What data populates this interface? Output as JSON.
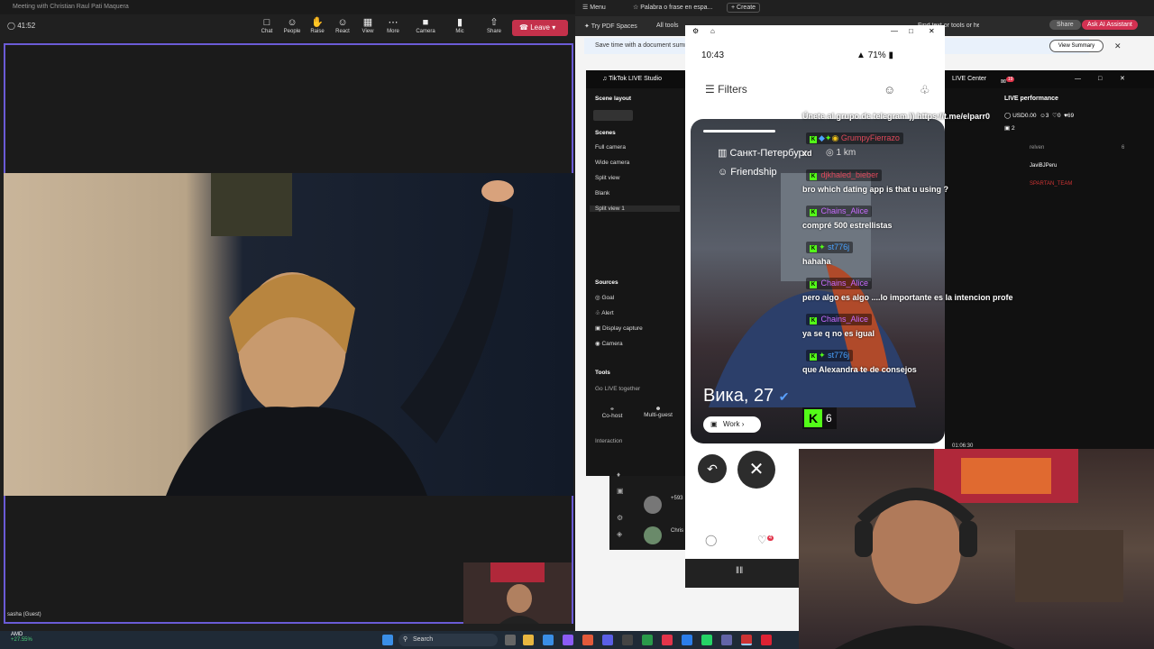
{
  "teams": {
    "window_title": "Meeting with Christian Raul Pati Maquera",
    "timer": "41:52",
    "toolbar": [
      {
        "label": "Chat",
        "icon": "chat-icon"
      },
      {
        "label": "People",
        "icon": "people-icon"
      },
      {
        "label": "Raise",
        "icon": "raise-hand-icon"
      },
      {
        "label": "React",
        "icon": "react-icon"
      },
      {
        "label": "View",
        "icon": "view-icon"
      },
      {
        "label": "More",
        "icon": "more-icon"
      },
      {
        "label": "Camera",
        "icon": "camera-icon"
      },
      {
        "label": "Mic",
        "icon": "mic-icon"
      },
      {
        "label": "Share",
        "icon": "share-icon"
      }
    ],
    "leave_label": "Leave",
    "participant_label": "sasha (Guest)"
  },
  "taskbar": {
    "stock_name": "AMD",
    "stock_change": "+27.55%",
    "search_label": "Search"
  },
  "browser": {
    "menu_label": "Menu",
    "tab_title": "Palabra o frase en espa...",
    "new_tab": "Create",
    "pdf_spaces": "Try PDF Spaces",
    "all_tools": "All tools",
    "find_text": "Find text or tools or help",
    "share_label": "Share",
    "ask_ai": "Ask AI Assistant",
    "notice": "Save time with a document summa",
    "view_summary": "View Summary"
  },
  "tiktok_studio": {
    "title": "TikTok LIVE Studio",
    "scene_layout": "Scene layout",
    "scenes_heading": "Scenes",
    "scenes": [
      "Full camera",
      "Wide camera",
      "Split view",
      "Blank",
      "Split view 1"
    ],
    "sources_heading": "Sources",
    "sources": [
      "Goal",
      "Alert",
      "Display capture",
      "Camera"
    ],
    "tools_heading": "Tools",
    "go_live_together": "Go LIVE together",
    "cohost": "Co-host",
    "multiguest": "Multi-guest",
    "interaction": "Interaction",
    "live_center": "LIVE Center",
    "notif_count": "19",
    "live_performance": "LIVE performance",
    "usd": "USD0.00",
    "stat_a": "3",
    "stat_b": "0",
    "stat_c": "69",
    "stat_d": "2",
    "viewers": [
      "relven",
      "JaviBJPeru",
      "SPARTAN_TEAM"
    ],
    "viewer_count": "6",
    "stream_time": "01:06:30",
    "list_user": "+593",
    "list_user2": "Chris"
  },
  "phone": {
    "time": "10:43",
    "battery": "71%",
    "filters": "Filters",
    "city": "Санкт-Петербург",
    "distance": "1 km",
    "tag": "Friendship",
    "name_age": "Вика, 27",
    "work_chip": "Work",
    "like_badge": "4"
  },
  "chat": {
    "pinned": "Únete al grupo de telegram )) https://t.me/elparr0",
    "messages": [
      {
        "user": "GrumpyFierrazo",
        "text": "xd",
        "color": "#e0485a"
      },
      {
        "user": "djkhaled_bieber",
        "text": "bro which dating app is that u using ?",
        "color": "#e0485a"
      },
      {
        "user": "Chains_Alice",
        "text": "compré 500 estrellistas",
        "color": "#c86bff"
      },
      {
        "user": "st776j",
        "text": "hahaha",
        "color": "#4aa3ff"
      },
      {
        "user": "Chains_Alice",
        "text": "pero algo es algo ....lo importante es la intencion profe",
        "color": "#c86bff"
      },
      {
        "user": "Chains_Alice",
        "text": "ya se q no es igual",
        "color": "#c86bff"
      },
      {
        "user": "st776j",
        "text": "que Alexandra te de consejos",
        "color": "#4aa3ff"
      }
    ],
    "kick_count": "6"
  }
}
